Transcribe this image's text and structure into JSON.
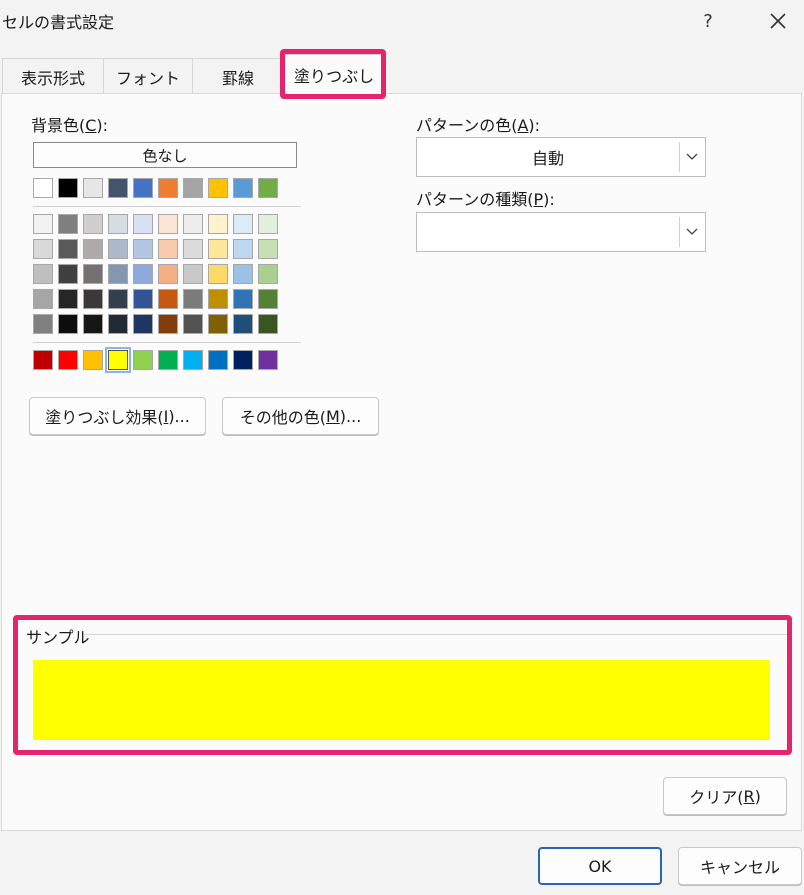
{
  "window": {
    "title": "セルの書式設定",
    "help_label": "?"
  },
  "tabs": [
    {
      "label": "表示形式"
    },
    {
      "label": "フォント"
    },
    {
      "label": "罫線"
    },
    {
      "label": "塗りつぶし",
      "active": true
    }
  ],
  "background_color": {
    "label_prefix": "背景色(",
    "accel": "C",
    "label_suffix": "):",
    "no_color_label": "色なし",
    "selected_color": "#FFFF00",
    "theme_top_row": [
      "#FFFFFF",
      "#000000",
      "#E7E6E6",
      "#44546A",
      "#4472C4",
      "#ED7D31",
      "#A5A5A5",
      "#FFC000",
      "#5B9BD5",
      "#70AD47"
    ],
    "theme_shades": [
      [
        "#F2F2F2",
        "#7F7F7F",
        "#D0CECE",
        "#D6DCE4",
        "#D9E1F2",
        "#FCE4D6",
        "#EDEDED",
        "#FFF2CC",
        "#DDEBF7",
        "#E2EFDA"
      ],
      [
        "#D9D9D9",
        "#595959",
        "#AEAAAA",
        "#ACB9CA",
        "#B4C6E7",
        "#F8CBAD",
        "#DBDBDB",
        "#FFE699",
        "#BDD7EE",
        "#C6E0B4"
      ],
      [
        "#BFBFBF",
        "#404040",
        "#757171",
        "#8497B0",
        "#8EA9DB",
        "#F4B084",
        "#C9C9C9",
        "#FFD966",
        "#9BC2E6",
        "#A9D08E"
      ],
      [
        "#A6A6A6",
        "#262626",
        "#3A3838",
        "#333F4F",
        "#305496",
        "#C65911",
        "#7B7B7B",
        "#BF8F00",
        "#2F75B5",
        "#548235"
      ],
      [
        "#808080",
        "#0D0D0D",
        "#161616",
        "#222B35",
        "#203764",
        "#833C0C",
        "#525252",
        "#806000",
        "#1F4E78",
        "#375623"
      ]
    ],
    "standard_colors": [
      "#C00000",
      "#FF0000",
      "#FFC000",
      "#FFFF00",
      "#92D050",
      "#00B050",
      "#00B0F0",
      "#0070C0",
      "#002060",
      "#7030A0"
    ]
  },
  "buttons": {
    "fill_effects": {
      "prefix": "塗りつぶし効果(",
      "accel": "I",
      "suffix": ")..."
    },
    "more_colors": {
      "prefix": "その他の色(",
      "accel": "M",
      "suffix": ")..."
    },
    "clear": {
      "prefix": "クリア(",
      "accel": "R",
      "suffix": ")"
    },
    "ok": "OK",
    "cancel": "キャンセル"
  },
  "pattern_color": {
    "label_prefix": "パターンの色(",
    "accel": "A",
    "label_suffix": "):",
    "value": "自動"
  },
  "pattern_style": {
    "label_prefix": "パターンの種類(",
    "accel": "P",
    "label_suffix": "):",
    "value": ""
  },
  "sample": {
    "label": "サンプル",
    "fill_color": "#FFFF00"
  },
  "highlight_color": "#E6246B"
}
